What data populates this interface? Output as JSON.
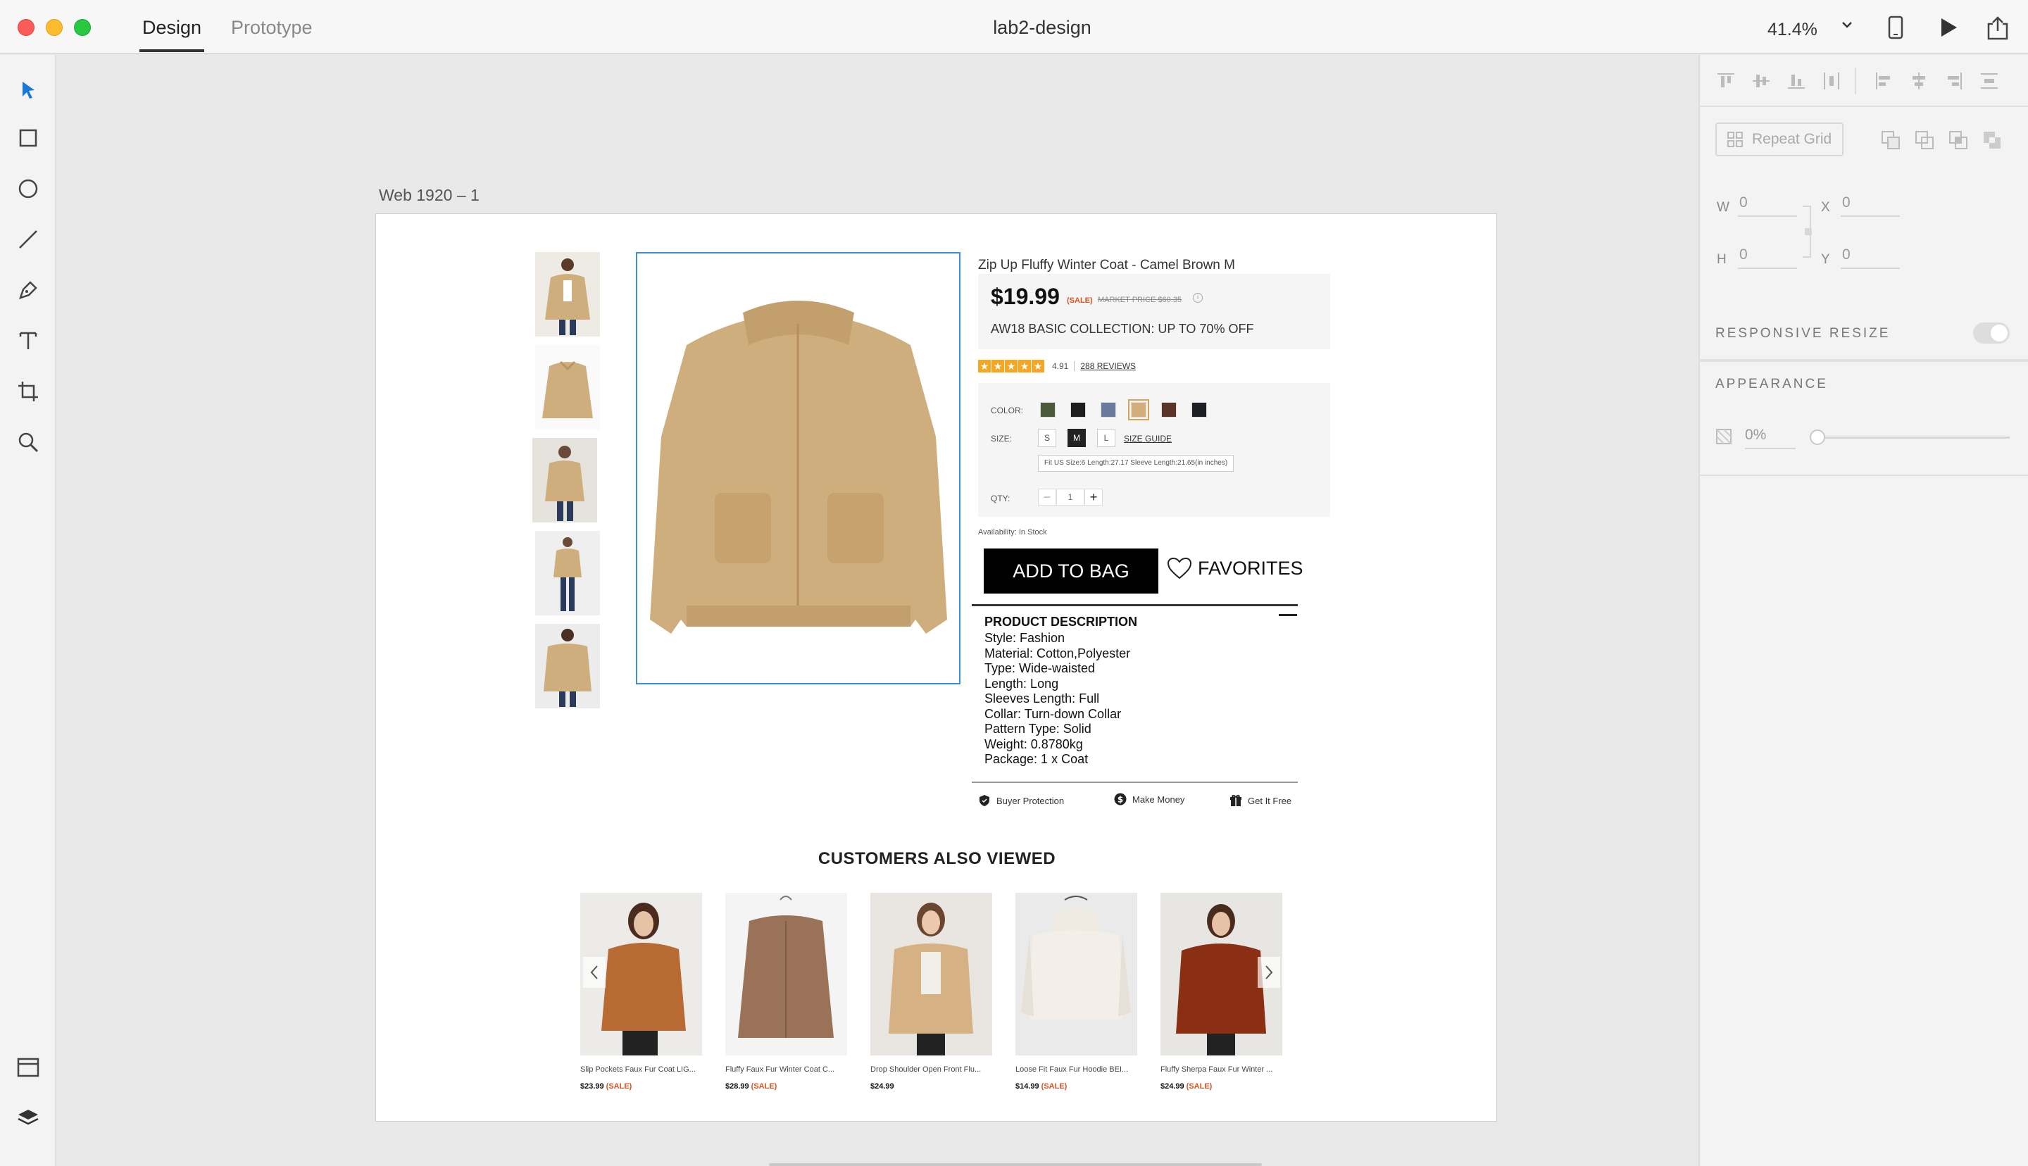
{
  "window": {
    "tabs": [
      "Design",
      "Prototype"
    ],
    "active_tab": "Design",
    "document_title": "lab2-design",
    "zoom": "41.4%"
  },
  "toolbar": {
    "tools": [
      "select-icon",
      "rectangle-icon",
      "ellipse-icon",
      "line-icon",
      "pen-icon",
      "text-icon",
      "artboard-icon",
      "zoom-icon"
    ],
    "bottom": [
      "assets-icon",
      "layers-icon"
    ]
  },
  "artboard": {
    "name": "Web 1920 – 1",
    "product": {
      "title": "Zip Up Fluffy Winter Coat - Camel Brown M",
      "price": "$19.99",
      "sale_tag": "(SALE)",
      "market_price": "MARKET PRICE $60.35",
      "promo": "AW18 BASIC COLLECTION: UP TO 70% OFF",
      "rating": 4.91,
      "rating_text": "4.91",
      "stars": 5,
      "reviews": "288 REVIEWS",
      "color_label": "COLOR:",
      "colors": [
        "#4a5a3a",
        "#1e1e1e",
        "#6a7a9c",
        "#d3ae7a",
        "#5a3426",
        "#1c1f26"
      ],
      "selected_color": 3,
      "size_label": "SIZE:",
      "sizes": [
        "S",
        "M",
        "L"
      ],
      "selected_size": "M",
      "size_guide": "SIZE GUIDE",
      "size_info": "Fit US Size:6   Length:27.17   Sleeve Length:21.65(in inches)",
      "qty_label": "QTY:",
      "qty_minus": "−",
      "qty": "1",
      "qty_plus": "+",
      "availability": "Availability: In Stock",
      "add_to_bag": "ADD TO BAG",
      "favorites": "FAVORITES",
      "description_title": "PRODUCT DESCRIPTION",
      "description": [
        "Style: Fashion",
        "Material: Cotton,Polyester",
        "Type: Wide-waisted",
        "Length: Long",
        "Sleeves Length: Full",
        "Collar: Turn-down Collar",
        "Pattern Type: Solid",
        "Weight: 0.8780kg",
        "Package: 1 x Coat"
      ],
      "assurances": [
        "Buyer Protection",
        "Make Money",
        "Get It Free"
      ]
    },
    "also_viewed": {
      "title": "CUSTOMERS ALSO VIEWED",
      "items": [
        {
          "name": "Slip Pockets Faux Fur Coat LIG...",
          "price": "$23.99",
          "sale": "(SALE)"
        },
        {
          "name": "Fluffy Faux Fur Winter Coat C...",
          "price": "$28.99",
          "sale": "(SALE)"
        },
        {
          "name": "Drop Shoulder Open Front Flu...",
          "price": "$24.99",
          "sale": ""
        },
        {
          "name": "Loose Fit Faux Fur Hoodie BEI...",
          "price": "$14.99",
          "sale": "(SALE)"
        },
        {
          "name": "Fluffy Sherpa Faux Fur Winter ...",
          "price": "$24.99",
          "sale": "(SALE)"
        }
      ]
    }
  },
  "panel": {
    "repeat_grid": "Repeat Grid",
    "w_label": "W",
    "w": "0",
    "h_label": "H",
    "h": "0",
    "x_label": "X",
    "x": "0",
    "y_label": "Y",
    "y": "0",
    "responsive_resize": "RESPONSIVE RESIZE",
    "appearance": "APPEARANCE",
    "opacity": "0%"
  }
}
